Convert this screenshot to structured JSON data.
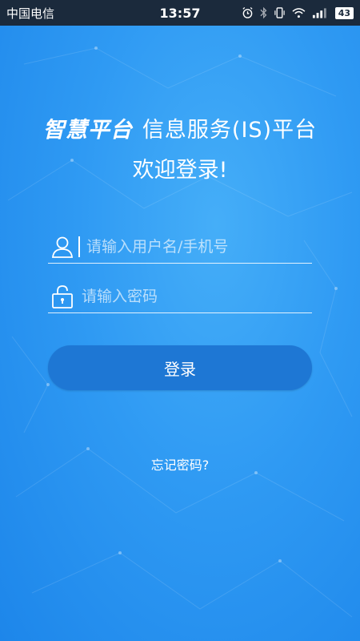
{
  "status_bar": {
    "carrier": "中国电信",
    "time": "13:57",
    "battery": "43",
    "icons": [
      "alarm-icon",
      "bluetooth-icon",
      "vibrate-icon",
      "wifi-icon",
      "signal-icon",
      "battery-icon"
    ]
  },
  "header": {
    "brand": "智慧平台",
    "subtitle": "信息服务(IS)平台",
    "welcome": "欢迎登录!"
  },
  "form": {
    "username_placeholder": "请输入用户名/手机号",
    "username_value": "",
    "password_placeholder": "请输入密码",
    "password_value": "",
    "login_label": "登录",
    "forgot_label": "忘记密码?"
  },
  "colors": {
    "background": "#2f9af3",
    "button": "#1e77d4",
    "status_bar": "#1b2a3c"
  }
}
